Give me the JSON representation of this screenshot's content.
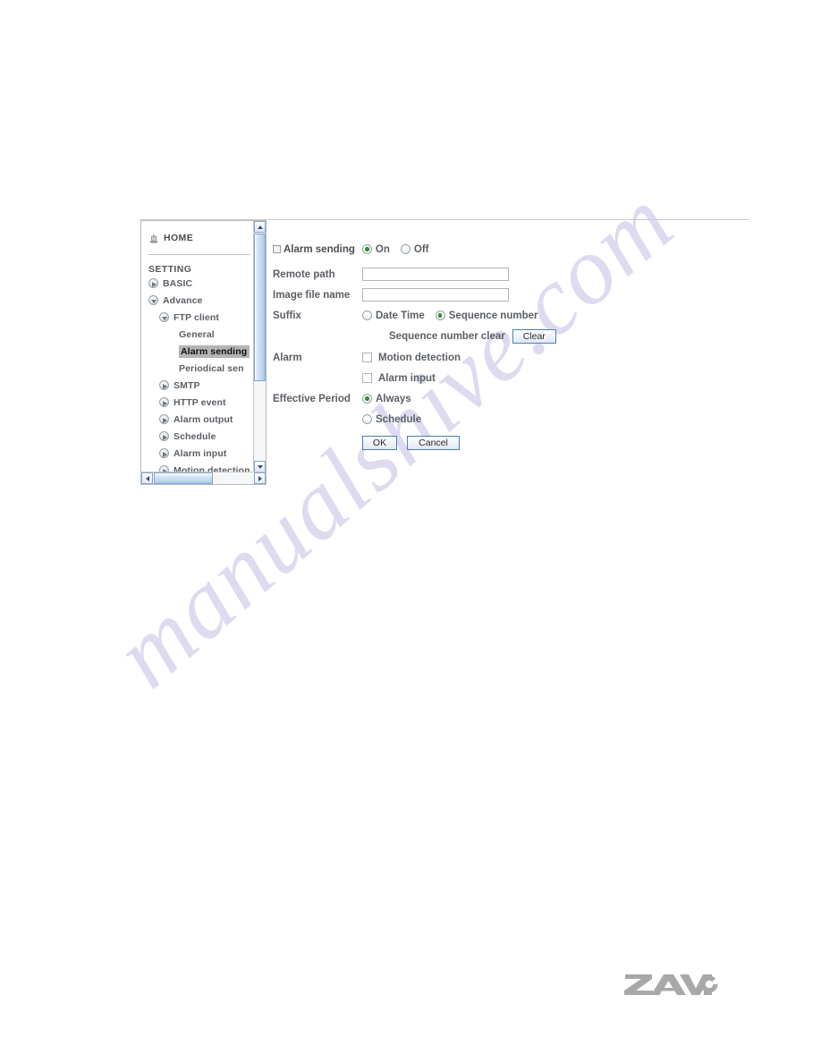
{
  "page": {
    "watermark_text": "manualshive.com",
    "brand_logo_text": "ZAVIO",
    "brand_logo_color": "#a8a8a8"
  },
  "sidebar": {
    "home_label": "HOME",
    "home_icon": "home-icon",
    "section_label": "SETTING",
    "items": [
      {
        "label": "BASIC",
        "level": 1,
        "icon": "triangle-right-icon",
        "expanded": false,
        "selected": false
      },
      {
        "label": "Advance",
        "level": 1,
        "icon": "triangle-down-icon",
        "expanded": true,
        "selected": false
      },
      {
        "label": "FTP client",
        "level": 2,
        "icon": "triangle-down-icon",
        "expanded": true,
        "selected": false
      },
      {
        "label": "General",
        "level": 3,
        "icon": "none",
        "expanded": false,
        "selected": false
      },
      {
        "label": "Alarm sending",
        "level": 3,
        "icon": "none",
        "expanded": false,
        "selected": true
      },
      {
        "label": "Periodical sen",
        "level": 3,
        "icon": "none",
        "expanded": false,
        "selected": false
      },
      {
        "label": "SMTP",
        "level": 2,
        "icon": "triangle-right-icon",
        "expanded": false,
        "selected": false
      },
      {
        "label": "HTTP event",
        "level": 2,
        "icon": "triangle-right-icon",
        "expanded": false,
        "selected": false
      },
      {
        "label": "Alarm output",
        "level": 2,
        "icon": "triangle-right-icon",
        "expanded": false,
        "selected": false
      },
      {
        "label": "Schedule",
        "level": 2,
        "icon": "triangle-right-icon",
        "expanded": false,
        "selected": false
      },
      {
        "label": "Alarm input",
        "level": 2,
        "icon": "triangle-right-icon",
        "expanded": false,
        "selected": false
      },
      {
        "label": "Motion detection",
        "level": 2,
        "icon": "triangle-right-icon",
        "expanded": false,
        "selected": false
      }
    ],
    "scrollbar": {
      "up_arrow": "scroll-up-arrow-icon",
      "down_arrow": "scroll-down-arrow-icon",
      "left_arrow": "scroll-left-arrow-icon",
      "right_arrow": "scroll-right-arrow-icon"
    }
  },
  "form": {
    "header": {
      "title": "Alarm sending",
      "on_label": "On",
      "off_label": "Off",
      "on_selected": true,
      "off_selected": false
    },
    "remote_path": {
      "label": "Remote path",
      "value": "",
      "placeholder": ""
    },
    "image_file_name": {
      "label": "Image file name",
      "value": "",
      "placeholder": ""
    },
    "suffix": {
      "label": "Suffix",
      "date_time_label": "Date Time",
      "date_time_selected": false,
      "sequence_number_label": "Sequence number",
      "sequence_number_selected": true
    },
    "sequence_clear": {
      "label": "Sequence number clear",
      "button_label": "Clear"
    },
    "alarm": {
      "label": "Alarm",
      "options": [
        {
          "label": "Motion detection",
          "checked": false
        },
        {
          "label": "Alarm input",
          "checked": false
        }
      ]
    },
    "effective_period": {
      "label": "Effective Period",
      "options": [
        {
          "label": "Always",
          "selected": true
        },
        {
          "label": "Schedule",
          "selected": false
        }
      ]
    },
    "buttons": {
      "ok_label": "OK",
      "cancel_label": "Cancel"
    }
  }
}
